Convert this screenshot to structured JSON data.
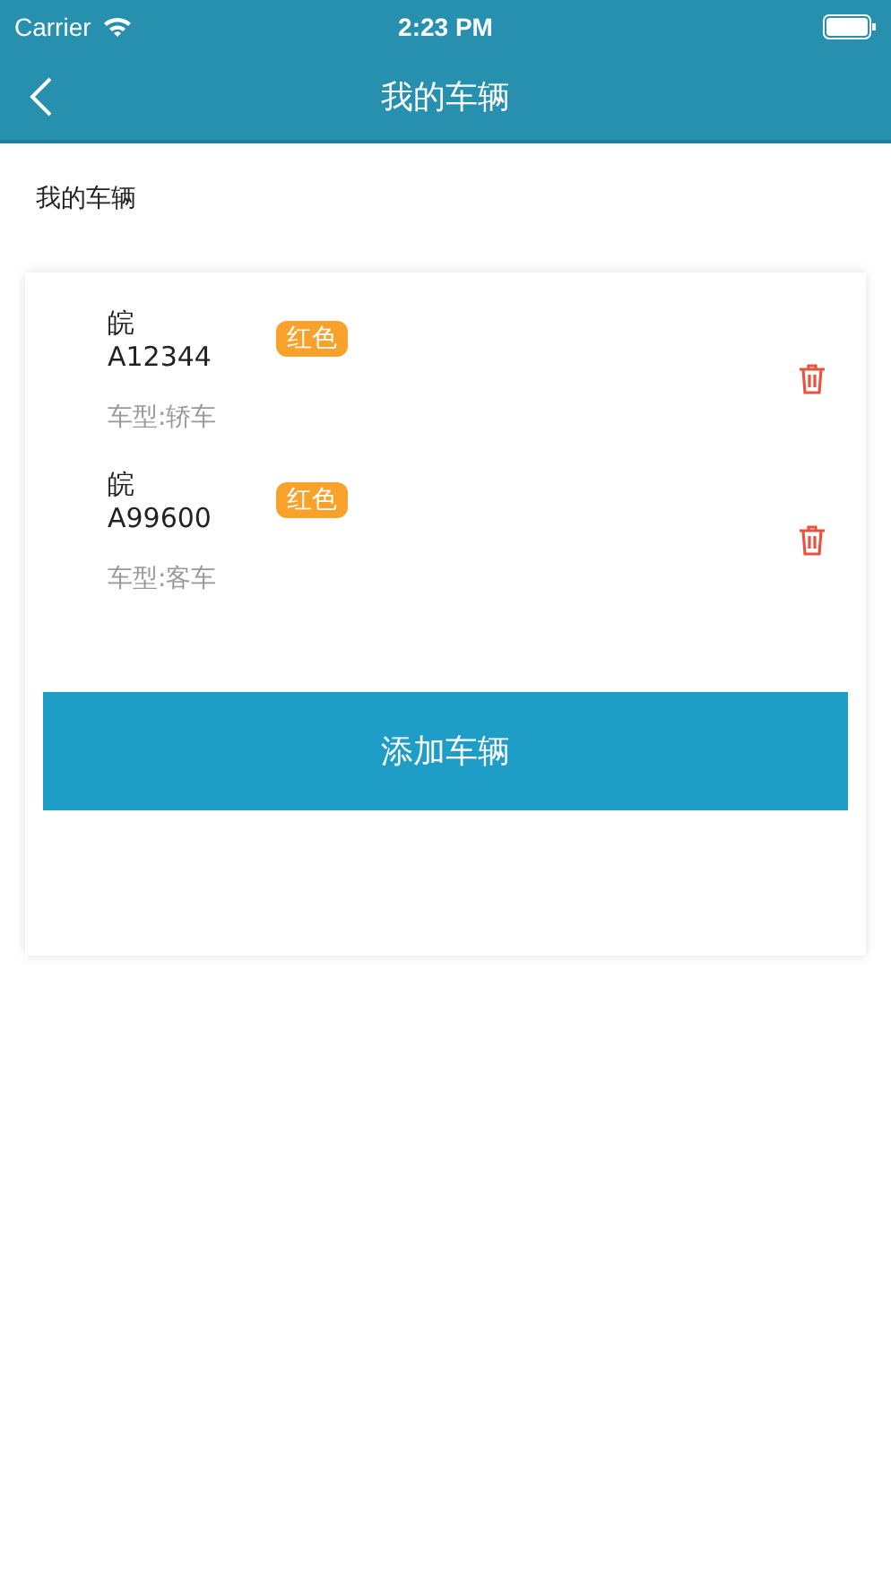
{
  "status_bar": {
    "carrier": "Carrier",
    "time": "2:23 PM"
  },
  "nav": {
    "title": "我的车辆"
  },
  "section_title": "我的车辆",
  "vehicles": [
    {
      "plate": "皖A12344",
      "tag": "红色",
      "type": "车型:轿车"
    },
    {
      "plate": "皖A99600",
      "tag": "红色",
      "type": "车型:客车"
    }
  ],
  "add_button": "添加车辆"
}
